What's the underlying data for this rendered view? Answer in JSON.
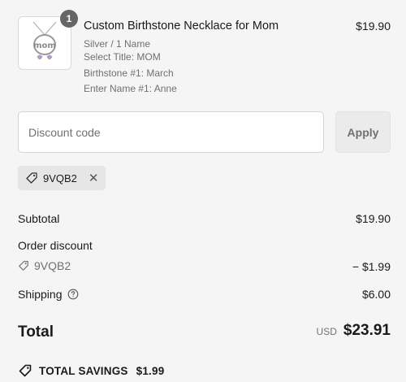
{
  "product": {
    "quantity": "1",
    "title": "Custom Birthstone Necklace for Mom",
    "price": "$19.90",
    "details": [
      "Silver / 1 Name",
      "Select Title: MOM",
      "Birthstone #1: March",
      "Enter Name #1: Anne"
    ],
    "thumbnail_text": "mom"
  },
  "discount": {
    "placeholder": "Discount code",
    "value": "",
    "apply_label": "Apply",
    "applied_code": "9VQB2"
  },
  "summary": {
    "subtotal_label": "Subtotal",
    "subtotal_value": "$19.90",
    "order_discount_label": "Order discount",
    "discount_code": "9VQB2",
    "discount_value": "− $1.99",
    "shipping_label": "Shipping",
    "shipping_value": "$6.00",
    "total_label": "Total",
    "currency": "USD",
    "total_value": "$23.91",
    "savings_label": "TOTAL SAVINGS",
    "savings_value": "$1.99"
  }
}
